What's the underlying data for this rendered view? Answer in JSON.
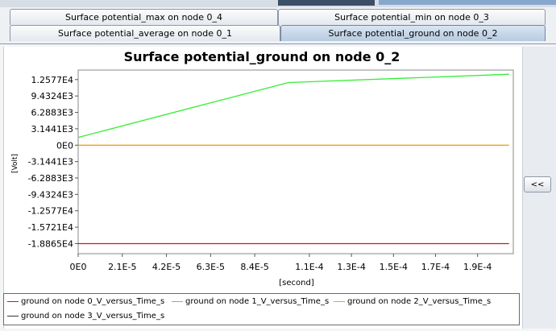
{
  "tabs": {
    "row1": [
      "Surface potential_max on node 0_4",
      "Surface potential_min on node 0_3"
    ],
    "row2": [
      "Surface potential_average on node 0_1",
      "Surface potential_ground on node 0_2"
    ],
    "active": "Surface potential_ground on node 0_2"
  },
  "collapse_label": "<<",
  "chart_data": {
    "type": "line",
    "title": "Surface potential_ground on node 0_2",
    "xlabel": "[second]",
    "ylabel": "[Volt]",
    "xlim": [
      0,
      0.000207
    ],
    "ylim": [
      -20800,
      14400
    ],
    "x_ticks": [
      {
        "v": 0,
        "label": "0E0"
      },
      {
        "v": 2.1e-05,
        "label": "2.1E-5"
      },
      {
        "v": 4.2e-05,
        "label": "4.2E-5"
      },
      {
        "v": 6.3e-05,
        "label": "6.3E-5"
      },
      {
        "v": 8.4e-05,
        "label": "8.4E-5"
      },
      {
        "v": 0.00011,
        "label": "1.1E-4"
      },
      {
        "v": 0.00013,
        "label": "1.3E-4"
      },
      {
        "v": 0.00015,
        "label": "1.5E-4"
      },
      {
        "v": 0.00017,
        "label": "1.7E-4"
      },
      {
        "v": 0.00019,
        "label": "1.9E-4"
      }
    ],
    "y_ticks": [
      {
        "v": 12577,
        "label": "1.2577E4"
      },
      {
        "v": 9432.4,
        "label": "9.4324E3"
      },
      {
        "v": 6288.3,
        "label": "6.2883E3"
      },
      {
        "v": 3144.1,
        "label": "3.1441E3"
      },
      {
        "v": 0,
        "label": "0E0"
      },
      {
        "v": -3144.1,
        "label": "-3.1441E3"
      },
      {
        "v": -6288.3,
        "label": "-6.2883E3"
      },
      {
        "v": -9432.4,
        "label": "-9.4324E3"
      },
      {
        "v": -12577,
        "label": "-1.2577E4"
      },
      {
        "v": -15721,
        "label": "-1.5721E4"
      },
      {
        "v": -18865,
        "label": "-1.8865E4"
      }
    ],
    "series": [
      {
        "name": "ground on node 0_V_versus_Time_s",
        "color": "#e01010",
        "x": [
          0,
          0.0001,
          0.000205
        ],
        "y": [
          -18865,
          -18865,
          -18865
        ]
      },
      {
        "name": "ground on node 1_V_versus_Time_s",
        "color": "#33ee33",
        "x": [
          0,
          0.0001,
          0.000205
        ],
        "y": [
          1500,
          12000,
          13600
        ]
      },
      {
        "name": "ground on node 2_V_versus_Time_s",
        "color": "#f0a020",
        "x": [
          0,
          0.0001,
          0.000205
        ],
        "y": [
          0,
          0,
          0
        ]
      },
      {
        "name": "ground on node 3_V_versus_Time_s",
        "color": "#333333",
        "x": [],
        "y": []
      }
    ],
    "grid": false,
    "legend_position": "bottom"
  }
}
